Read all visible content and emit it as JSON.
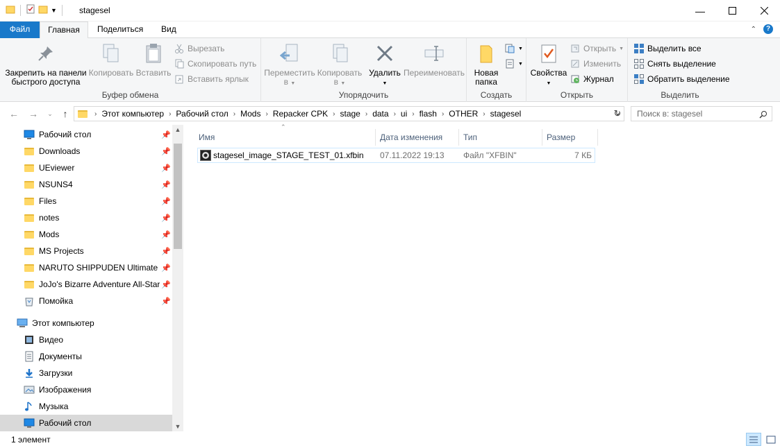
{
  "window": {
    "title": "stagesel",
    "controls": [
      "minimize-icon",
      "maximize-icon",
      "close-icon"
    ]
  },
  "ribbon_tabs": [
    "Файл",
    "Главная",
    "Поделиться",
    "Вид"
  ],
  "ribbon": {
    "clipboard": {
      "label": "Буфер обмена",
      "pin": "Закрепить на панели быстрого доступа",
      "pin_line1": "Закрепить на панели",
      "pin_line2": "быстрого доступа",
      "copy": "Копировать",
      "paste": "Вставить",
      "cut": "Вырезать",
      "copy_path": "Скопировать путь",
      "paste_shortcut": "Вставить ярлык"
    },
    "organize": {
      "label": "Упорядочить",
      "move_line1": "Переместить",
      "move_line2": "в",
      "copy_line1": "Копировать",
      "copy_line2": "в",
      "delete": "Удалить",
      "rename": "Переименовать"
    },
    "new": {
      "label": "Создать",
      "new_folder_line1": "Новая",
      "new_folder_line2": "папка"
    },
    "open": {
      "label": "Открыть",
      "properties": "Свойства",
      "open": "Открыть",
      "edit": "Изменить",
      "history": "Журнал"
    },
    "select": {
      "label": "Выделить",
      "select_all": "Выделить все",
      "select_none": "Снять выделение",
      "invert": "Обратить выделение"
    }
  },
  "address": {
    "crumbs": [
      "Этот компьютер",
      "Рабочий стол",
      "Mods",
      "Repacker CPK",
      "stage",
      "data",
      "ui",
      "flash",
      "OTHER",
      "stagesel"
    ],
    "search_placeholder": "Поиск в: stagesel"
  },
  "nav": {
    "quick_access": [
      {
        "label": "Рабочий стол",
        "icon": "desktop-icon"
      },
      {
        "label": "Downloads",
        "icon": "folder-icon"
      },
      {
        "label": "UEviewer",
        "icon": "folder-icon"
      },
      {
        "label": "NSUNS4",
        "icon": "folder-icon"
      },
      {
        "label": "Files",
        "icon": "folder-icon"
      },
      {
        "label": "notes",
        "icon": "folder-icon"
      },
      {
        "label": "Mods",
        "icon": "folder-icon"
      },
      {
        "label": "MS Projects",
        "icon": "folder-icon"
      },
      {
        "label": "NARUTO SHIPPUDEN Ultimate Nin",
        "icon": "folder-icon"
      },
      {
        "label": "JoJo's Bizarre Adventure All-Star B",
        "icon": "folder-icon"
      },
      {
        "label": "Помойка",
        "icon": "recycle-bin-icon"
      }
    ],
    "this_pc": "Этот компьютер",
    "pc_items": [
      {
        "label": "Видео",
        "icon": "video-icon"
      },
      {
        "label": "Документы",
        "icon": "documents-icon"
      },
      {
        "label": "Загрузки",
        "icon": "download-icon"
      },
      {
        "label": "Изображения",
        "icon": "pictures-icon"
      },
      {
        "label": "Музыка",
        "icon": "music-icon"
      },
      {
        "label": "Рабочий стол",
        "icon": "desktop-icon"
      }
    ]
  },
  "columns": [
    "Имя",
    "Дата изменения",
    "Тип",
    "Размер"
  ],
  "files": [
    {
      "name": "stagesel_image_STAGE_TEST_01.xfbin",
      "date": "07.11.2022 19:13",
      "type": "Файл \"XFBIN\"",
      "size": "7 КБ"
    }
  ],
  "status": {
    "count": "1 элемент"
  },
  "colors": {
    "file_tab": "#1979ca",
    "ribbon_bg": "#f5f6f7",
    "selection_border": "#cce8ff"
  }
}
